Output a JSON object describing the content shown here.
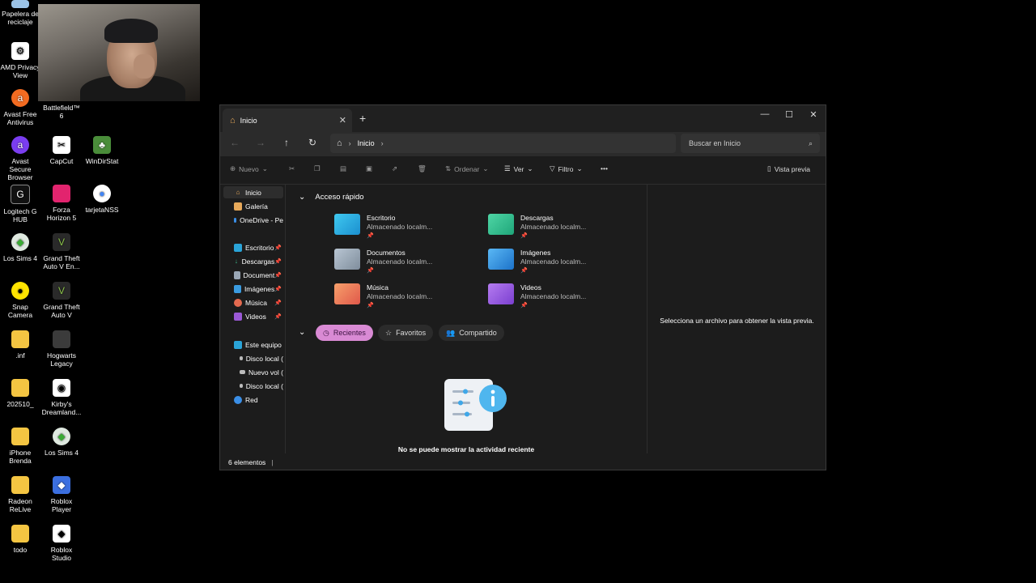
{
  "desktop": {
    "icons": [
      {
        "label": "Papelera de reciclaje",
        "icon": "recycle-bin-icon"
      },
      {
        "label": "AMD Privacy View",
        "icon": "amd-icon"
      },
      {
        "label": "Avast Free Antivirus",
        "icon": "avast-icon"
      },
      {
        "label": "Battlefield™ 6",
        "icon": "battlefield-icon"
      },
      {
        "label": "Avast Secure Browser",
        "icon": "avast-browser-icon"
      },
      {
        "label": "CapCut",
        "icon": "capcut-icon"
      },
      {
        "label": "WinDirStat",
        "icon": "windirstat-icon"
      },
      {
        "label": "Logitech G HUB",
        "icon": "logitech-icon"
      },
      {
        "label": "Forza Horizon 5",
        "icon": "forza-icon"
      },
      {
        "label": "tarjetaNSS",
        "icon": "chrome-icon"
      },
      {
        "label": "Los Sims 4",
        "icon": "sims-icon"
      },
      {
        "label": "Grand Theft Auto V En...",
        "icon": "gta-icon"
      },
      {
        "label": "Snap Camera",
        "icon": "snap-camera-icon"
      },
      {
        "label": "Grand Theft Auto V",
        "icon": "gta-icon"
      },
      {
        "label": ".inf",
        "icon": "folder-icon"
      },
      {
        "label": "Hogwarts Legacy",
        "icon": "hogwarts-icon"
      },
      {
        "label": "202510_",
        "icon": "folder-icon"
      },
      {
        "label": "Kirby's Dreamland...",
        "icon": "kirby-icon"
      },
      {
        "label": "iPhone Brenda",
        "icon": "folder-icon"
      },
      {
        "label": "Los Sims 4",
        "icon": "sims-icon"
      },
      {
        "label": "Radeon ReLive",
        "icon": "folder-icon"
      },
      {
        "label": "Roblox Player",
        "icon": "roblox-icon"
      },
      {
        "label": "todo",
        "icon": "folder-icon"
      },
      {
        "label": "Roblox Studio",
        "icon": "roblox-studio-icon"
      }
    ]
  },
  "explorer": {
    "tab_title": "Inicio",
    "address": {
      "crumb": "Inicio"
    },
    "search_placeholder": "Buscar en Inicio",
    "toolbar": {
      "new_label": "Nuevo",
      "sort_label": "Ordenar",
      "view_label": "Ver",
      "filter_label": "Filtro",
      "more_label": "•••",
      "preview_label": "Vista previa"
    },
    "sidebar": {
      "top": [
        "Inicio",
        "Galería",
        "OneDrive - Pe"
      ],
      "pinned": [
        "Escritorio",
        "Descargas",
        "Document",
        "Imágenes",
        "Música",
        "Videos"
      ],
      "pc": [
        "Este equipo",
        "Disco local (",
        "Nuevo vol (",
        "Disco local ("
      ],
      "network": "Red"
    },
    "quick_access": {
      "title": "Acceso rápido",
      "items": [
        {
          "name": "Escritorio",
          "sub": "Almacenado localm..."
        },
        {
          "name": "Descargas",
          "sub": "Almacenado localm..."
        },
        {
          "name": "Documentos",
          "sub": "Almacenado localm..."
        },
        {
          "name": "Imágenes",
          "sub": "Almacenado localm..."
        },
        {
          "name": "Música",
          "sub": "Almacenado localm..."
        },
        {
          "name": "Videos",
          "sub": "Almacenado localm..."
        }
      ]
    },
    "chips": {
      "recent": "Recientes",
      "favorites": "Favoritos",
      "shared": "Compartido"
    },
    "empty_message": "No se puede mostrar la actividad reciente",
    "preview_message": "Selecciona un archivo para obtener la vista previa.",
    "status": "6 elementos"
  },
  "colors": {
    "accent_chip": "#d98ad4",
    "window_bg": "#1c1c1c"
  }
}
